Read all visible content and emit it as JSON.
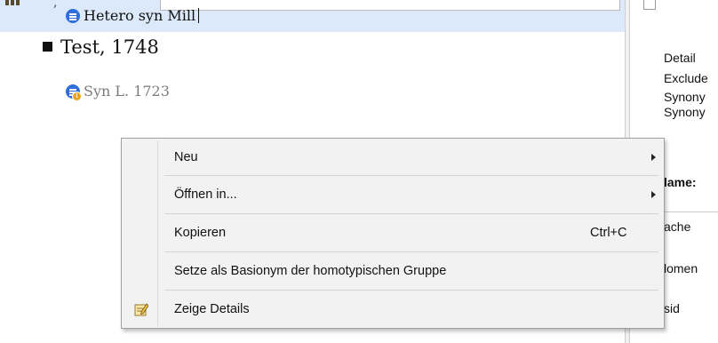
{
  "tree": {
    "accepted_name": "Test, 1748",
    "synonym_name": "Syn L. 1723",
    "selected_name_visible": "Hetero syn Mill"
  },
  "detail_panel": {
    "labels": [
      "Detail",
      "Exclude",
      "Synony",
      "Synony"
    ],
    "field_labels": [
      "lame:",
      "ache",
      "lomen",
      "sid"
    ]
  },
  "context_menu": {
    "items": [
      {
        "label": "Neu",
        "submenu": true
      },
      {
        "label": "Öffnen in...",
        "submenu": true
      },
      {
        "label": "Kopieren",
        "shortcut": "Ctrl+C"
      },
      {
        "label": "Setze als Basionym der homotypischen Gruppe"
      },
      {
        "label": "Zeige Details",
        "icon": "edit-details-icon"
      }
    ]
  },
  "colors": {
    "selection": "#dbe9fb",
    "synonym_icon": "#2f6fdc",
    "warning_badge": "#e8a415",
    "menu_background": "#f2f2f2"
  }
}
